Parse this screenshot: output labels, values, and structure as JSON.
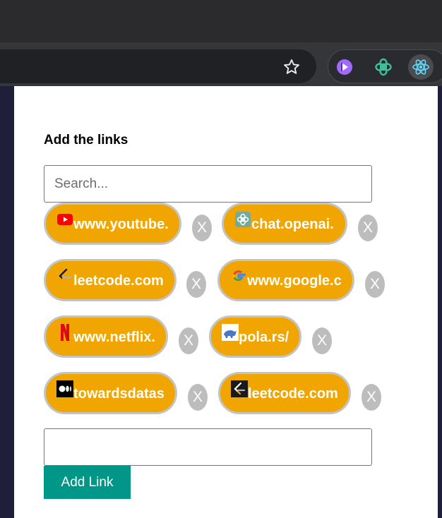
{
  "popup": {
    "title": "Add the links",
    "search_placeholder": "Search...",
    "link_input_value": "",
    "add_button_label": "Add Link",
    "remove_label": "X",
    "links": [
      {
        "label": "www.youtube.",
        "icon": "youtube-icon"
      },
      {
        "label": "chat.openai.",
        "icon": "openai-icon"
      },
      {
        "label": "leetcode.com",
        "icon": "leetcode-icon"
      },
      {
        "label": "www.google.c",
        "icon": "google-icon"
      },
      {
        "label": "www.netflix.",
        "icon": "netflix-icon"
      },
      {
        "label": "pola.rs/",
        "icon": "polars-icon"
      },
      {
        "label": "towardsdatas",
        "icon": "medium-icon"
      },
      {
        "label": "leetcode.com",
        "icon": "leetcode-dark-icon"
      }
    ]
  },
  "toolbar": {
    "extensions": [
      "video-player-extension-icon",
      "chatgpt-extension-icon",
      "react-extension-icon"
    ],
    "bookmark_icon": "star-icon"
  },
  "colors": {
    "chip_background": "#f0a500",
    "chip_border": "#c4c4c4",
    "add_button": "#009688",
    "remove_button": "#bdbdbd"
  }
}
